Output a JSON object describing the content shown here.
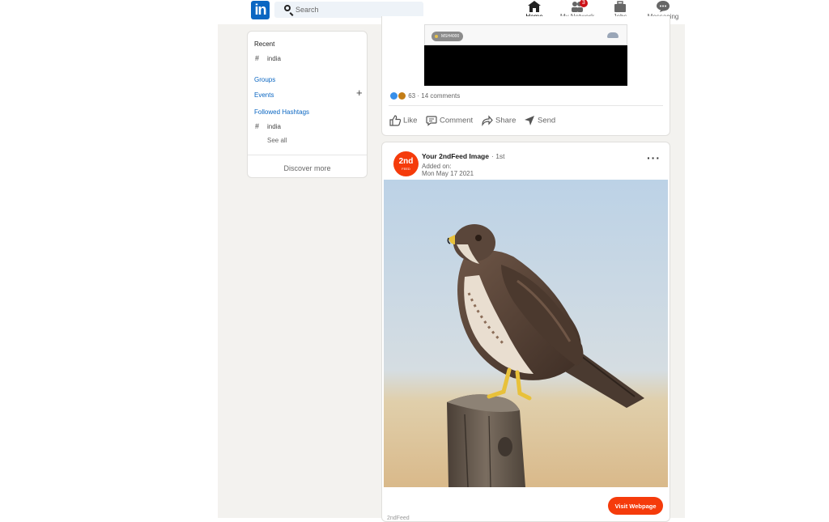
{
  "nav": {
    "search_placeholder": "Search",
    "items": [
      {
        "label": "Home",
        "icon": "home-icon"
      },
      {
        "label": "My Network",
        "icon": "network-icon",
        "badge": "3"
      },
      {
        "label": "Jobs",
        "icon": "briefcase-icon"
      },
      {
        "label": "Messaging",
        "icon": "messaging-icon"
      }
    ]
  },
  "sidebar": {
    "recent_heading": "Recent",
    "recent_items": [
      "india"
    ],
    "groups": "Groups",
    "events": "Events",
    "followed_hashtags": "Followed Hashtags",
    "hashtags": [
      "india"
    ],
    "see_all": "See all",
    "discover_more": "Discover more"
  },
  "post1": {
    "media_tag": "MSH4000",
    "reaction_count": "63",
    "comments": "14 comments",
    "actions": {
      "like": "Like",
      "comment": "Comment",
      "share": "Share",
      "send": "Send"
    }
  },
  "post2": {
    "avatar_text": "2nd",
    "avatar_sub": "FEED",
    "author": "Your 2ndFeed Image",
    "degree": "· 1st",
    "added_label": "Added on:",
    "added_date": "Mon May 17 2021",
    "image_subject": "hawk perched on wooden post",
    "visit_button": "Visit Webpage",
    "footer_text": "2ndFeed"
  },
  "colors": {
    "linkedin_blue": "#0a66c2",
    "page_bg": "#f3f2ef",
    "accent_orange": "#f53b0b",
    "badge_red": "#cc1016"
  }
}
